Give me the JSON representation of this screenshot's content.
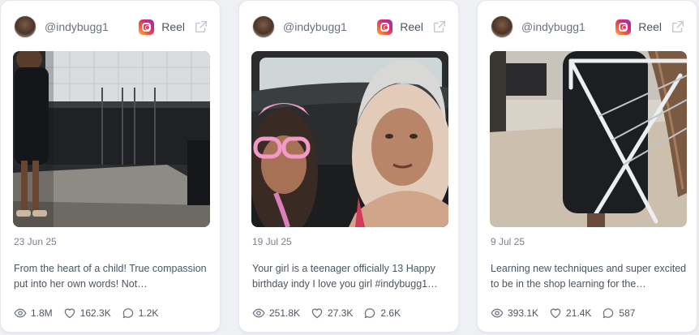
{
  "cards": [
    {
      "handle": "@indybugg1",
      "type": "Reel",
      "date": "23 Jun 25",
      "caption": "From the heart of a child! True compassion put into her own words! Not…",
      "views": "1.8M",
      "likes": "162.3K",
      "comments": "1.2K"
    },
    {
      "handle": "@indybugg1",
      "type": "Reel",
      "date": "19 Jul 25",
      "caption": "Your girl is a teenager officially 13 Happy birthday indy I love you girl #indybugg1…",
      "views": "251.8K",
      "likes": "27.3K",
      "comments": "2.6K"
    },
    {
      "handle": "@indybugg1",
      "type": "Reel",
      "date": "9 Jul 25",
      "caption": "Learning new techniques and super excited to be in the shop learning for the…",
      "views": "393.1K",
      "likes": "21.4K",
      "comments": "587"
    }
  ],
  "icons": {
    "platform": "instagram-icon",
    "open": "external-link-icon",
    "views": "eye-icon",
    "likes": "heart-icon",
    "comments": "comment-icon"
  }
}
